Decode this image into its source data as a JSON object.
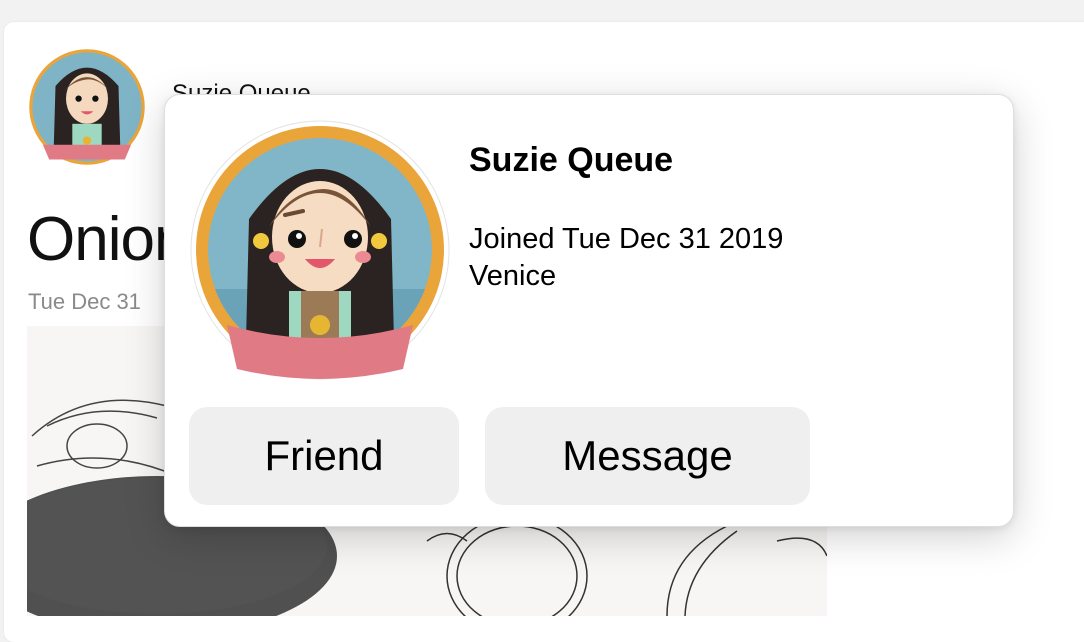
{
  "post": {
    "author_name": "Suzie Queue",
    "title": "Onion",
    "date": "Tue Dec 31",
    "image_alt": "pencil sketch of onions"
  },
  "profile_popup": {
    "name": "Suzie Queue",
    "joined": "Joined Tue Dec 31 2019",
    "location": "Venice",
    "friend_label": "Friend",
    "message_label": "Message"
  },
  "colors": {
    "avatar_ring": "#eaa53a",
    "avatar_bg": "#7fb4c7",
    "ribbon": "#e07b86",
    "button_bg": "#efefef"
  }
}
